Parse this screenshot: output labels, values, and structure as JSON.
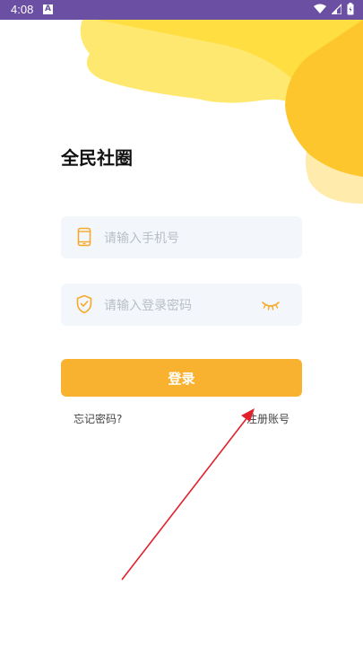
{
  "status_bar": {
    "time": "4:08",
    "notification_badge": "A"
  },
  "app": {
    "title": "全民社圈"
  },
  "form": {
    "phone_placeholder": "请输入手机号",
    "password_placeholder": "请输入登录密码",
    "login_label": "登录",
    "forgot_label": "忘记密码?",
    "register_label": "注册账号"
  },
  "colors": {
    "status_bar": "#6a4fa3",
    "accent": "#f9b22f",
    "field_bg": "#f3f7fb",
    "annotation_arrow": "#e0212b"
  },
  "icons": {
    "status": [
      "wifi-icon",
      "signal-icon",
      "battery-icon"
    ],
    "phone_field": "phone-icon",
    "password_field": "shield-check-icon",
    "password_toggle": "eye-closed-icon"
  }
}
